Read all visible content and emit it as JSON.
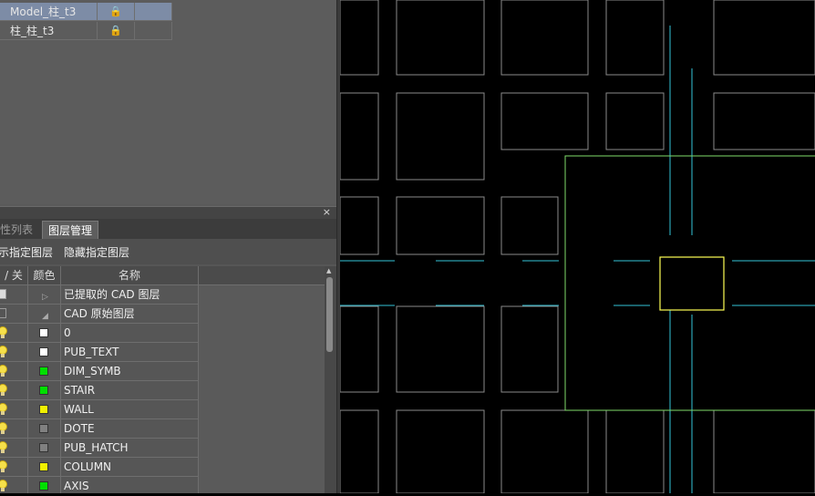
{
  "model_list": {
    "rows": [
      {
        "name": "Model_柱_t3",
        "lock": "🔒",
        "selected": true
      },
      {
        "name": "柱_柱_t3",
        "lock": "🔒",
        "selected": false
      }
    ]
  },
  "panel": {
    "close": "×",
    "tabs": [
      "性列表",
      "图层管理"
    ],
    "active_tab": 1,
    "actions": [
      "示指定图层",
      "隐藏指定图层"
    ],
    "headers": {
      "onoff": "/ 关",
      "color": "颜色",
      "name": "名称"
    },
    "layers": [
      {
        "state": "checked",
        "color": "",
        "name": "已提取的 CAD 图层",
        "glyph": "▷"
      },
      {
        "state": "unchecked",
        "color": "",
        "name": "CAD 原始图层",
        "glyph": "◢"
      },
      {
        "state": "bulb",
        "color": "#ffffff",
        "name": "0"
      },
      {
        "state": "bulb",
        "color": "#ffffff",
        "name": "PUB_TEXT"
      },
      {
        "state": "bulb",
        "color": "#00e000",
        "name": "DIM_SYMB"
      },
      {
        "state": "bulb",
        "color": "#00e000",
        "name": "STAIR"
      },
      {
        "state": "bulb",
        "color": "#f0f000",
        "name": "WALL"
      },
      {
        "state": "bulb",
        "color": "#808080",
        "name": "DOTE"
      },
      {
        "state": "bulb",
        "color": "#808080",
        "name": "PUB_HATCH"
      },
      {
        "state": "bulb",
        "color": "#f0f000",
        "name": "COLUMN"
      },
      {
        "state": "bulb",
        "color": "#00e000",
        "name": "AXIS"
      }
    ]
  },
  "colors": {
    "rect": "#8a8a8a",
    "axis": "#33c4d8",
    "wall": "#7fdc6a",
    "column": "#ffff55"
  }
}
